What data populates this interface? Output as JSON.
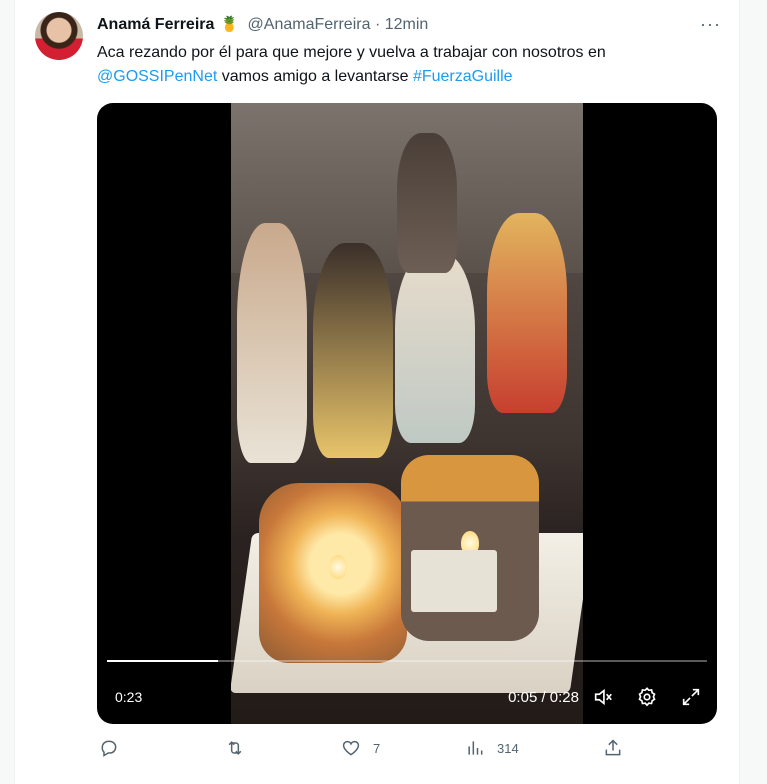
{
  "tweet": {
    "author_name": "Anamá Ferreira",
    "author_emoji": "🍍",
    "handle": "@AnamaFerreira",
    "separator": "·",
    "time": "12min",
    "more": "···",
    "text": {
      "part1": "Aca rezando por él para que mejore y vuelva a trabajar con nosotros en ",
      "mention": "@GOSSIPenNet",
      "part2": " vamos amigo a levantarse  ",
      "hashtag": "#FuerzaGuille"
    }
  },
  "video": {
    "left_time": "0:23",
    "time_display": "0:05 / 0:28",
    "progress_fraction": 0.185,
    "icons": [
      "mute-icon",
      "settings-icon",
      "fullscreen-icon"
    ]
  },
  "actions": {
    "reply": {
      "icon": "reply-icon",
      "count": ""
    },
    "retweet": {
      "icon": "retweet-icon",
      "count": ""
    },
    "like": {
      "icon": "heart-icon",
      "count": "7"
    },
    "views": {
      "icon": "views-icon",
      "count": "314"
    },
    "share": {
      "icon": "share-icon",
      "count": ""
    }
  },
  "colors": {
    "link": "#1d9bf0",
    "muted": "#536471",
    "text": "#0f1419"
  }
}
